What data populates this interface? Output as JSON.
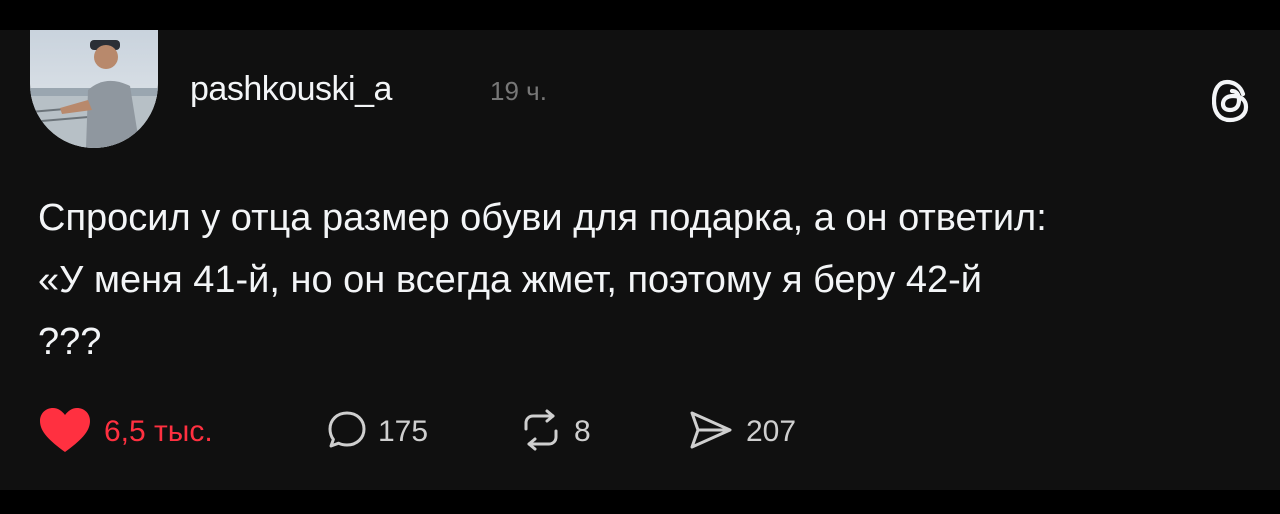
{
  "post": {
    "author": {
      "username": "pashkouski_a",
      "time_ago": "19 ч."
    },
    "text_lines": [
      "Спросил у отца размер обуви для подарка, а он ответил:",
      "«У меня 41-й, но он всегда жмет, поэтому я беру 42-й",
      "???"
    ],
    "stats": {
      "likes": "6,5 тыс.",
      "replies": "175",
      "reposts": "8",
      "shares": "207"
    }
  },
  "colors": {
    "background": "#101010",
    "text": "#f3f5f7",
    "muted": "#777777",
    "like_red": "#ff3040"
  },
  "icons": {
    "like": "heart-icon-filled",
    "reply": "speech-bubble-icon",
    "repost": "repost-arrows-icon",
    "share": "send-arrow-icon",
    "brand": "threads-logo-icon"
  }
}
